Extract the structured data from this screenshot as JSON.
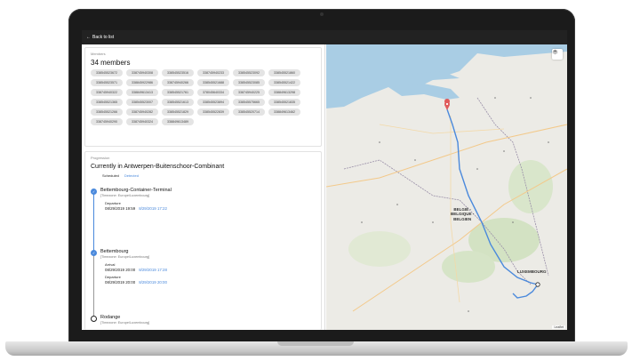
{
  "topbar": {
    "back_label": "Back to list"
  },
  "members": {
    "section_label": "Members",
    "count_label": "34 members",
    "ids": [
      "338545523672",
      "338745940308",
      "338545523516",
      "338745940233",
      "338545523092",
      "338545521860",
      "338545523571",
      "338845922986",
      "338745940266",
      "338545521688",
      "338545523085",
      "338545521422",
      "338745940322",
      "338849613413",
      "338545521761",
      "378045640334",
      "338745940225",
      "338849613298",
      "338545521365",
      "338545523007",
      "338545521613",
      "338545523894",
      "338545575665",
      "338545521835",
      "338545521266",
      "338745940282",
      "338545521829",
      "338545522839",
      "338545520714",
      "",
      "338849613462",
      "338745940290",
      "338745940324",
      "338849613489"
    ]
  },
  "progression": {
    "section_label": "Progression",
    "current": "Currently in Antwerpen-Buitenschoor-Combinant",
    "tab_scheduled": "Scheduled",
    "tab_detected": "Detected",
    "stops": [
      {
        "name": "Bettembourg-Container-Terminal",
        "tz": "[Timezone: Europe/Luxembourg]",
        "events": [
          {
            "label": "Departure",
            "scheduled": "08/29/2019 19:59",
            "detected": "8/29/2019 17:22"
          }
        ]
      },
      {
        "name": "Bettembourg",
        "tz": "[Timezone: Europe/Luxembourg]",
        "events": [
          {
            "label": "Arrival",
            "scheduled": "08/29/2019 20:00",
            "detected": "8/29/2019 17:28"
          },
          {
            "label": "Departure",
            "scheduled": "08/29/2019 20:00",
            "detected": "8/29/2019 20:00"
          }
        ]
      },
      {
        "name": "Rodange",
        "tz": "[Timezone: Europe/Luxembourg]",
        "events": []
      }
    ]
  },
  "map": {
    "labels": {
      "belgium": "BELGIË -\nBELGIQUE -\nBELGIEN",
      "luxembourg": "LUXEMBOURG"
    },
    "attribution": "Leaflet",
    "route_color": "#4a89dc",
    "water_color": "#a9cde4",
    "land_color": "#ecebe6"
  }
}
